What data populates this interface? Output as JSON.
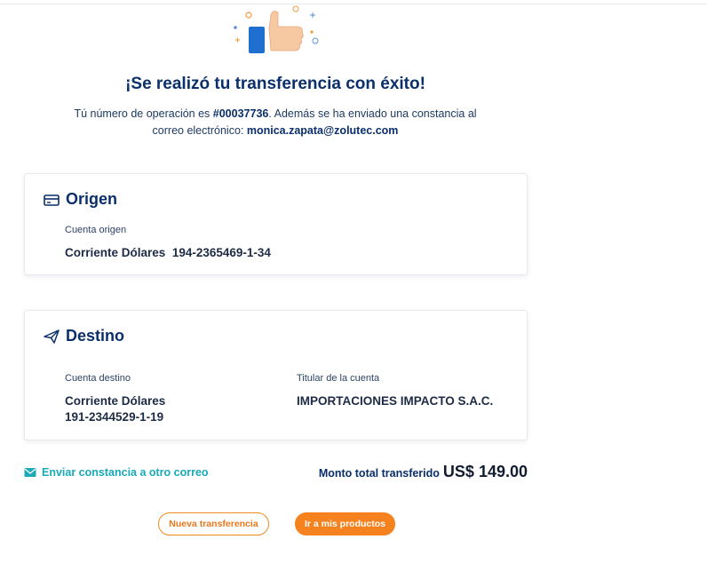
{
  "success": {
    "title": "¡Se realizó tu transferencia con éxito!",
    "op_prefix": "Tú número de operación es ",
    "op_number": "#00037736",
    "op_middle": ". Además se ha enviado una constancia al",
    "email_prefix": "correo electrónico: ",
    "email": "monica.zapata@zolutec.com"
  },
  "origen": {
    "title": "Origen",
    "account_label": "Cuenta origen",
    "account_type": "Corriente Dólares",
    "account_number": "194-2365469-1-34",
    "icon": "card-icon"
  },
  "destino": {
    "title": "Destino",
    "account_label": "Cuenta destino",
    "account_type": "Corriente Dólares",
    "account_number": "191-2344529-1-19",
    "holder_label": "Titular de la cuenta",
    "holder_name": "IMPORTACIONES IMPACTO S.A.C.",
    "icon": "paper-plane-icon"
  },
  "footer": {
    "send_link": "Enviar constancia a otro correo",
    "total_label": "Monto total transferido",
    "total_amount": "US$ 149.00"
  },
  "actions": {
    "new_transfer": "Nueva transferencia",
    "go_products": "Ir a mis productos"
  },
  "colors": {
    "navy": "#0a2f6b",
    "teal": "#1aaab8",
    "orange": "#f5821f"
  }
}
